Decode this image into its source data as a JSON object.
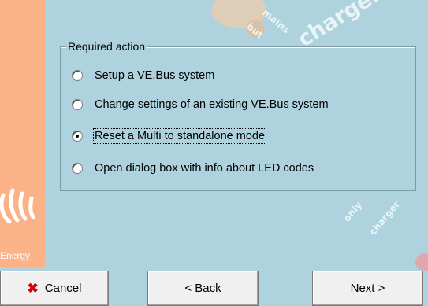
{
  "sidebar": {
    "brand_label": "Energy"
  },
  "background": {
    "text_mains_charger": "charger",
    "text_mains_small": "mains",
    "text_but": "but",
    "text_charger_only_1": "charger",
    "text_charger_only_2": "only"
  },
  "required_action": {
    "legend": "Required action",
    "options": [
      {
        "label": "Setup a  VE.Bus system",
        "checked": false
      },
      {
        "label": "Change settings of an existing VE.Bus system",
        "checked": false
      },
      {
        "label": "Reset a Multi to standalone mode",
        "checked": true
      },
      {
        "label": "Open dialog box with info about LED codes",
        "checked": false
      }
    ]
  },
  "buttons": {
    "cancel": "Cancel",
    "back": "< Back",
    "next": "Next >"
  },
  "colors": {
    "background": "#aed3df",
    "sidebar": "#fbb287",
    "cancel_icon": "#d40000"
  }
}
